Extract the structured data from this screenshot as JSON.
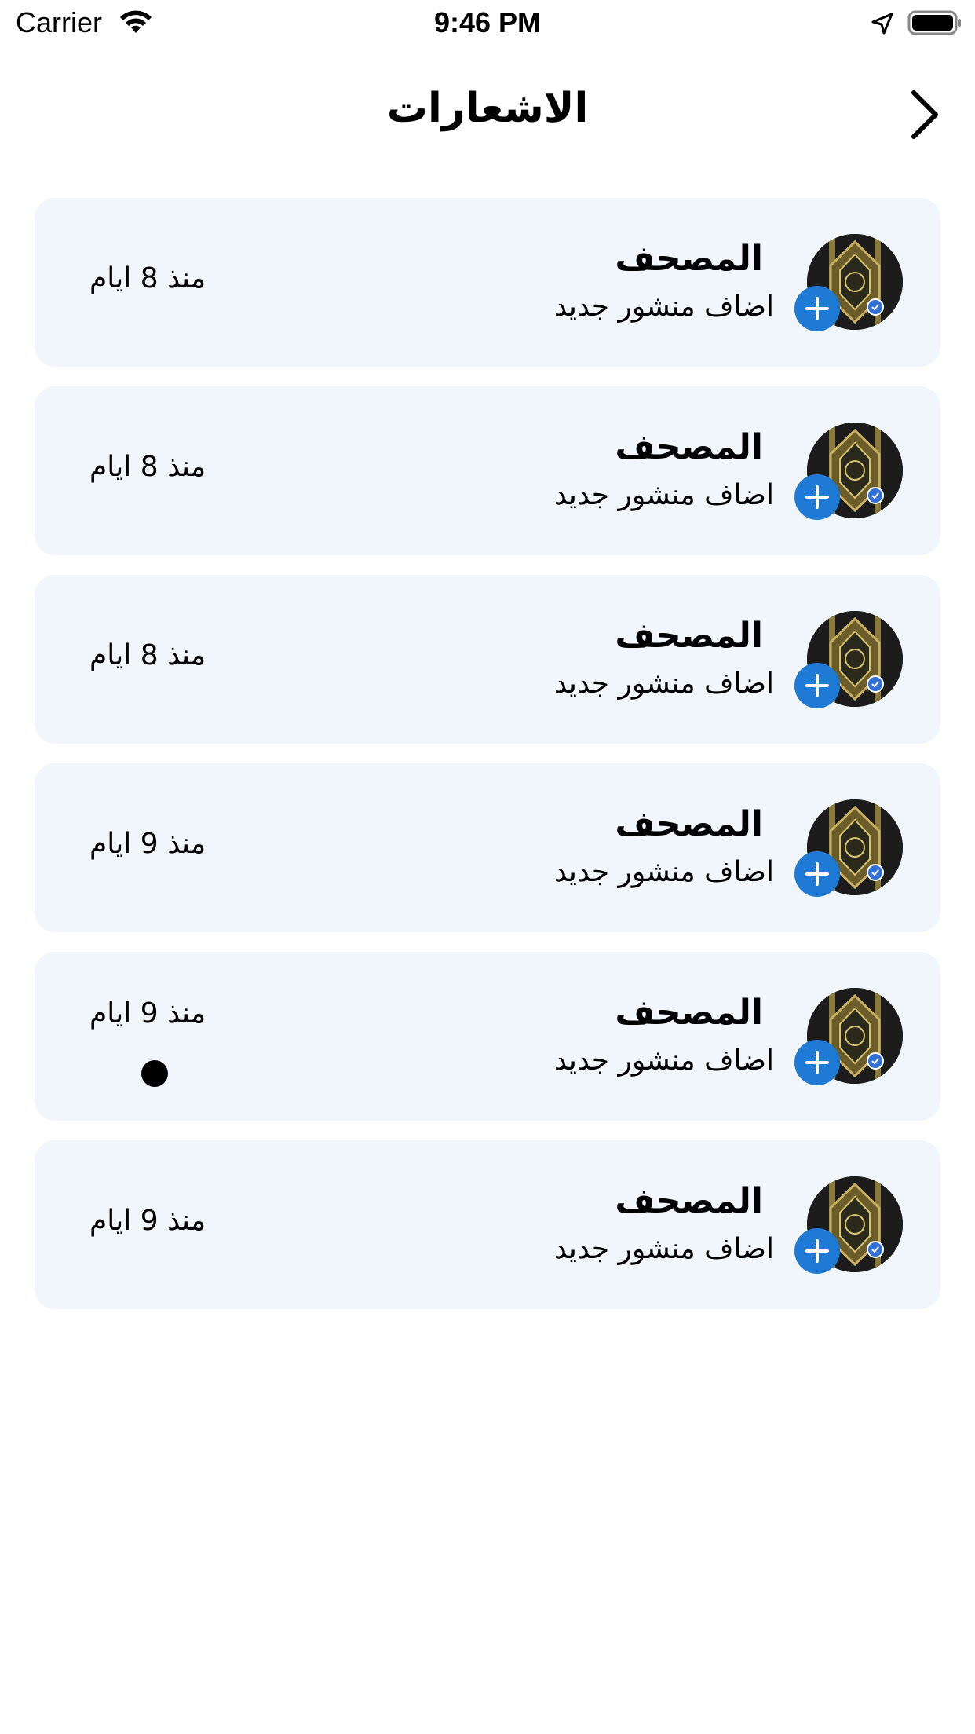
{
  "status_bar": {
    "carrier": "Carrier",
    "time": "9:46 PM",
    "icons": [
      "wifi-icon",
      "location-icon",
      "battery-icon"
    ]
  },
  "nav": {
    "title": "الاشعارات",
    "back_icon": "chevron-right-icon"
  },
  "colors": {
    "card_background": "#f0f6fb",
    "accent_blue": "#1f7ad6",
    "unread_dot": "#000000"
  },
  "notifications": [
    {
      "name": "المصحف",
      "action": "اضاف منشور جديد",
      "time": "منذ 8 ايام",
      "unread": false
    },
    {
      "name": "المصحف",
      "action": "اضاف منشور جديد",
      "time": "منذ 8 ايام",
      "unread": false
    },
    {
      "name": "المصحف",
      "action": "اضاف منشور جديد",
      "time": "منذ 8 ايام",
      "unread": false
    },
    {
      "name": "المصحف",
      "action": "اضاف منشور جديد",
      "time": "منذ 9 ايام",
      "unread": false
    },
    {
      "name": "المصحف",
      "action": "اضاف منشور جديد",
      "time": "منذ 9 ايام",
      "unread": true
    },
    {
      "name": "المصحف",
      "action": "اضاف منشور جديد",
      "time": "منذ 9 ايام",
      "unread": false
    }
  ]
}
